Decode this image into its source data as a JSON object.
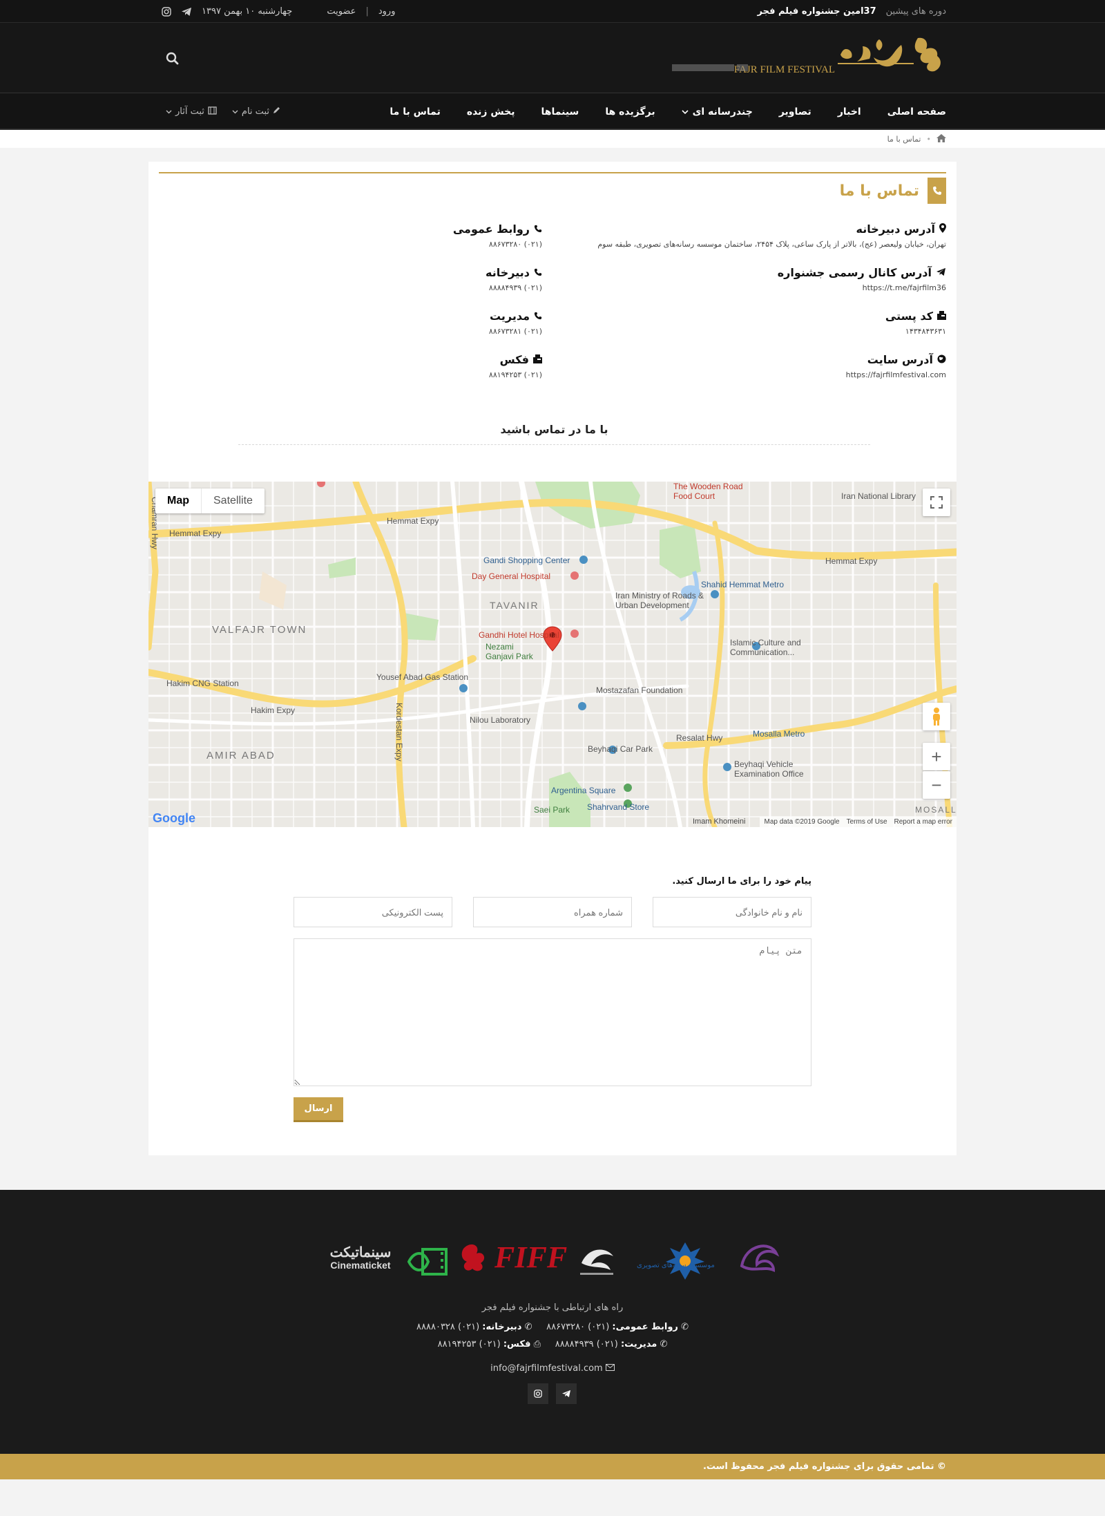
{
  "topbar": {
    "previous_editions": "دوره های پیشین",
    "edition_title": "37امین جشنواره فیلم فجر",
    "login": "ورود",
    "separator": "|",
    "register": "عضویت",
    "date": "چهارشنبه ۱۰ بهمن ۱۳۹۷"
  },
  "header": {
    "logo_latin": "FAJR FILM FESTIVAL",
    "logo_persian": "جشنواره فیلم فجر"
  },
  "nav": {
    "items": [
      {
        "label": "صفحه اصلی"
      },
      {
        "label": "اخبار"
      },
      {
        "label": "تصاویر"
      },
      {
        "label": "چندرسانه ای"
      },
      {
        "label": "برگزیده ها"
      },
      {
        "label": "سینماها"
      },
      {
        "label": "پخش زنده"
      },
      {
        "label": "تماس با ما"
      }
    ],
    "signup": "ثبت نام",
    "submit_work": "ثبت آثار"
  },
  "breadcrumb": {
    "current": "تماس با ما"
  },
  "contact": {
    "title": "تماس با ما",
    "address_label": "آدرس دبیرخانه",
    "address_value": "تهران، خیابان ولیعصر (عج)، بالاتر از پارک ساعی، پلاک ۲۴۵۴، ساختمان موسسه رسانه‌های تصویری، طبقه سوم",
    "channel_label": "آدرس کانال رسمی جشنواره",
    "channel_value": "https://t.me/fajrfilm36",
    "postal_label": "کد پستی",
    "postal_value": "۱۴۳۴۸۴۳۶۳۱",
    "site_label": "آدرس سایت",
    "site_value": "https://fajrfilmfestival.com",
    "pr_label": "روابط عمومی",
    "pr_value": "(۰۲۱) ۸۸۶۷۳۲۸۰",
    "secretariat_label": "دبیرخانه",
    "secretariat_value": "(۰۲۱) ۸۸۸۸۴۹۳۹",
    "management_label": "مدیریت",
    "management_value": "(۰۲۱) ۸۸۶۷۳۲۸۱",
    "fax_label": "فکس",
    "fax_value": "(۰۲۱) ۸۸۱۹۴۲۵۳",
    "get_in_touch": "با ما در تماس باشید"
  },
  "map": {
    "tab_map": "Map",
    "tab_satellite": "Satellite",
    "zoom_in": "+",
    "zoom_out": "−",
    "google": "Google",
    "footer_street": "Imam Khomeini",
    "map_data": "Map data ©2019 Google",
    "terms": "Terms of Use",
    "report": "Report a map error",
    "places": [
      "Hemmat Expy",
      "Iran National Library",
      "Gandi Shopping Center",
      "Day General Hospital",
      "TAVANIR",
      "Gandhi Hotel Hospital",
      "Nezami Ganjavi Park",
      "VALFAJR TOWN",
      "Hakim CNG Station",
      "Yousef Abad Gas Station",
      "Hakim Expy",
      "Shahid Hemmat Metro",
      "Iran Ministry of Roads & Urban Development",
      "Islamic Culture and Communication...",
      "Mostazafan Foundation",
      "Nilou Laboratory",
      "Beyhaqi Car Park",
      "Resalat Hwy",
      "Mosalla Metro",
      "Beyhaqi Vehicle Examination Office",
      "AMIR ABAD",
      "Argentina Square",
      "Shahrvand Store",
      "Saei Park",
      "Kordestan Expy",
      "Chamran Hwy",
      "The Wooden Road Food Court",
      "MOSALLA"
    ]
  },
  "form": {
    "title": "پیام خود را برای ما ارسال کنید.",
    "name_placeholder": "نام و نام خانوادگی",
    "mobile_placeholder": "شماره همراه",
    "email_placeholder": "پست الکترونیکی",
    "message_placeholder": "متن پیام",
    "submit": "ارسال"
  },
  "footer": {
    "partners": [
      "Cinematicket",
      "FIFF",
      "موسسه رسانه‌های تصویری"
    ],
    "title": "راه های ارتباطی با جشنواره فیلم فجر",
    "pr_label": "روابط عمومی:",
    "pr_value": "(۰۲۱) ۸۸۶۷۳۲۸۰",
    "secretariat_label": "دبیرخانه:",
    "secretariat_value": "(۰۲۱) ۸۸۸۸۰۳۲۸",
    "management_label": "مدیریت:",
    "management_value": "(۰۲۱) ۸۸۸۸۴۹۳۹",
    "fax_label": "فکس:",
    "fax_value": "(۰۲۱) ۸۸۱۹۴۲۵۳",
    "email": "info@fajrfilmfestival.com",
    "copyright": "© تمامی حقوق برای جشنواره فیلم فجر محفوظ است."
  },
  "colors": {
    "gold": "#c8a24a",
    "dark": "#141414"
  }
}
